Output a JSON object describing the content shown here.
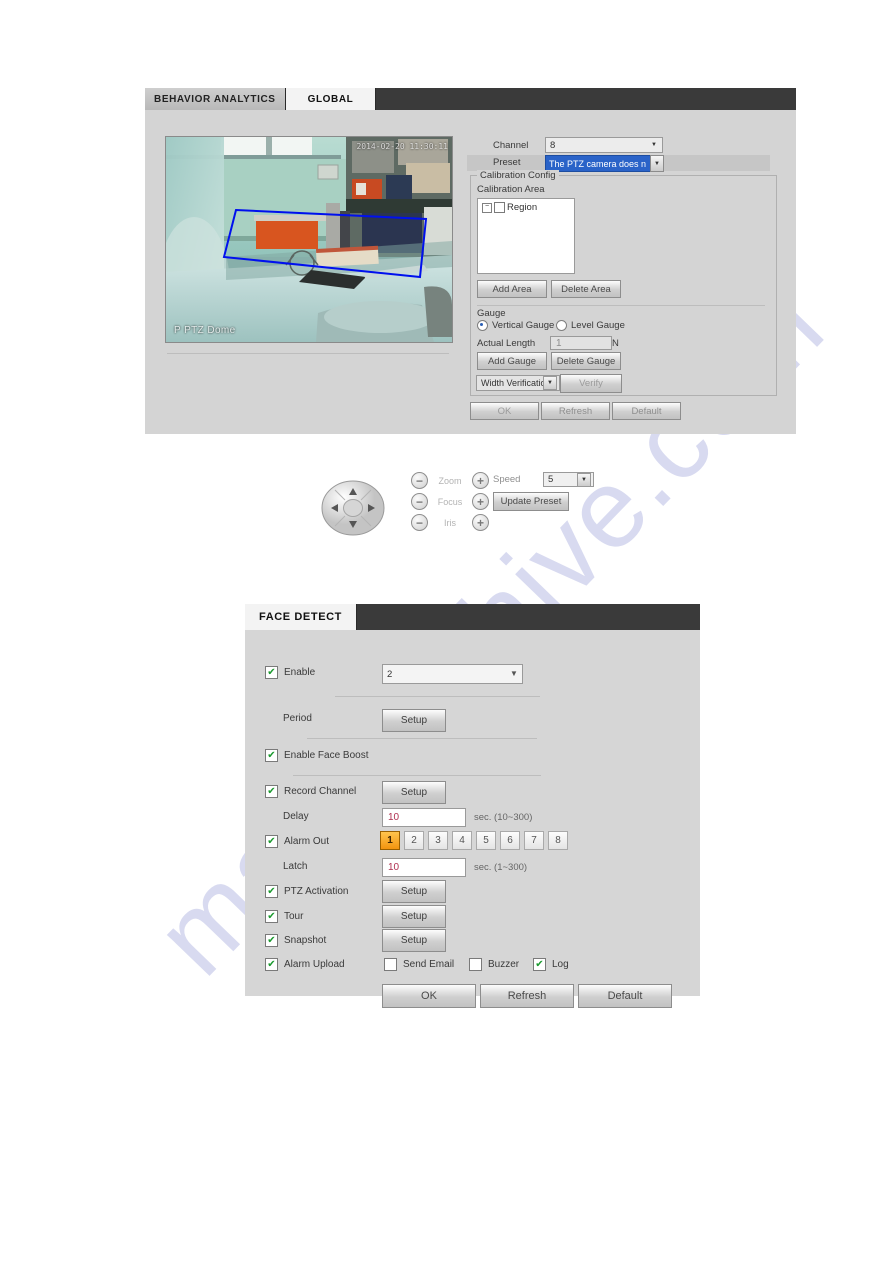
{
  "global_dialog": {
    "tabs": [
      {
        "label": "BEHAVIOR ANALYTICS",
        "active": false
      },
      {
        "label": "GLOBAL",
        "active": true
      }
    ],
    "video": {
      "timestamp": "2014-02-20 11:30:11",
      "camera_label": "P PTZ Dome"
    },
    "ptz": {
      "zoom_label": "Zoom",
      "focus_label": "Focus",
      "iris_label": "Iris",
      "minus": "−",
      "plus": "+",
      "speed_label": "Speed",
      "speed_value": "5",
      "update_preset_label": "Update Preset"
    },
    "channel_label": "Channel",
    "channel_value": "8",
    "preset_label": "Preset",
    "preset_value": "The PTZ camera does n",
    "calibration": {
      "group_legend": "Calibration Config",
      "area_label": "Calibration Area",
      "tree_item": "Region",
      "add_area_label": "Add Area",
      "delete_area_label": "Delete Area"
    },
    "gauge": {
      "legend": "Gauge",
      "vertical_label": "Vertical Gauge",
      "level_label": "Level Gauge",
      "vertical_selected": true,
      "actual_length_label": "Actual Length",
      "actual_length_value": "1",
      "actual_length_unit": "N",
      "add_gauge_label": "Add Gauge",
      "delete_gauge_label": "Delete Gauge",
      "verification_value": "Width Verification",
      "verify_label": "Verify"
    },
    "footer": {
      "ok_label": "OK",
      "refresh_label": "Refresh",
      "default_label": "Default"
    }
  },
  "face_dialog": {
    "tabs": [
      {
        "label": "FACE DETECT",
        "active": true
      }
    ],
    "enable": {
      "label": "Enable",
      "checked": true,
      "value": "2"
    },
    "period": {
      "label": "Period",
      "button": "Setup"
    },
    "face_boost": {
      "label": "Enable Face Boost",
      "checked": true
    },
    "record_channel": {
      "label": "Record Channel",
      "checked": true,
      "button": "Setup"
    },
    "delay": {
      "label": "Delay",
      "value": "10",
      "unit": "sec. (10~300)"
    },
    "alarm_out": {
      "label": "Alarm Out",
      "checked": true,
      "buttons": [
        "1",
        "2",
        "3",
        "4",
        "5",
        "6",
        "7",
        "8"
      ],
      "selected": "1"
    },
    "latch": {
      "label": "Latch",
      "value": "10",
      "unit": "sec. (1~300)"
    },
    "ptz_activation": {
      "label": "PTZ Activation",
      "checked": true,
      "button": "Setup"
    },
    "tour": {
      "label": "Tour",
      "checked": true,
      "button": "Setup"
    },
    "snapshot": {
      "label": "Snapshot",
      "checked": true,
      "button": "Setup"
    },
    "alarm_upload": {
      "label": "Alarm Upload",
      "checked": true,
      "send_email": {
        "label": "Send Email",
        "checked": false
      },
      "buzzer": {
        "label": "Buzzer",
        "checked": false
      },
      "log": {
        "label": "Log",
        "checked": true
      }
    },
    "footer": {
      "ok_label": "OK",
      "refresh_label": "Refresh",
      "default_label": "Default"
    }
  },
  "watermark": {
    "text": "manualshive.com"
  },
  "colors": {
    "panel_bg": "#d6d6d6",
    "tabbar_bg": "#3a3a3a",
    "accent_orange": "#f2940f",
    "selection_blue": "#2a63c8",
    "check_green": "#1a9a2e",
    "overlay_blue": "#0010ee",
    "watermark": "#b9bde4"
  }
}
